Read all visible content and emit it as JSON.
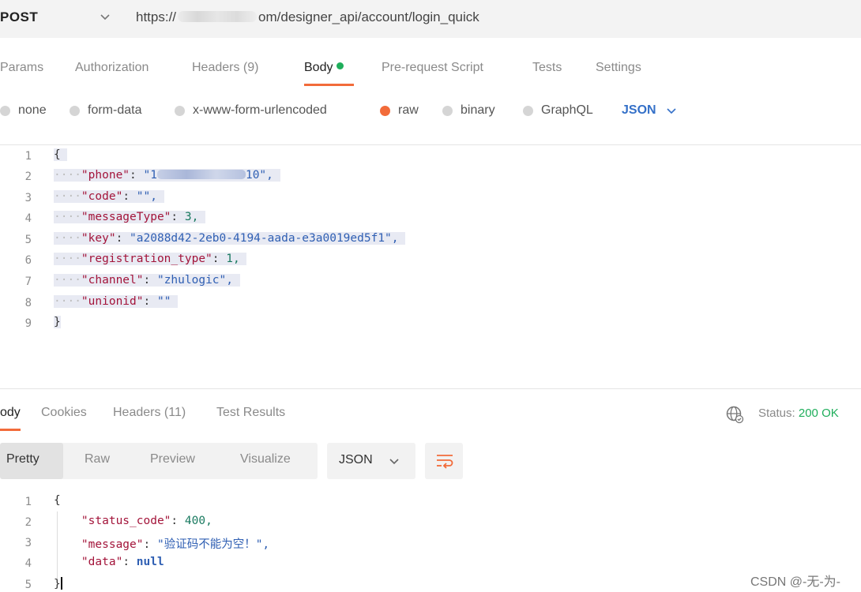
{
  "request": {
    "method": "POST",
    "url_prefix": "https://",
    "url_suffix": "om/designer_api/account/login_quick"
  },
  "tabs": [
    "Params",
    "Authorization",
    "Headers (9)",
    "Body",
    "Pre-request Script",
    "Tests",
    "Settings"
  ],
  "active_tab": "Body",
  "body_types": [
    "none",
    "form-data",
    "x-www-form-urlencoded",
    "raw",
    "binary",
    "GraphQL"
  ],
  "selected_body_type": "raw",
  "body_language": "JSON",
  "request_body": {
    "line_numbers": [
      "1",
      "2",
      "3",
      "4",
      "5",
      "6",
      "7",
      "8",
      "9"
    ],
    "open_brace": "{",
    "close_brace": "}",
    "fields": [
      {
        "key": "\"phone\"",
        "value": "\"1",
        "value_tail": "10\","
      },
      {
        "key": "\"code\"",
        "value": "\"\","
      },
      {
        "key": "\"messageType\"",
        "value": "3,"
      },
      {
        "key": "\"key\"",
        "value": "\"a2088d42-2eb0-4194-aada-e3a0019ed5f1\","
      },
      {
        "key": "\"registration_type\"",
        "value": "1,"
      },
      {
        "key": "\"channel\"",
        "value": "\"zhulogic\","
      },
      {
        "key": "\"unionid\"",
        "value": "\"\""
      }
    ]
  },
  "response": {
    "tabs": [
      "ody",
      "Cookies",
      "Headers (11)",
      "Test Results"
    ],
    "status_label": "Status:",
    "status_value": "200 OK",
    "view_modes": [
      "Pretty",
      "Raw",
      "Preview",
      "Visualize"
    ],
    "format": "JSON",
    "line_numbers": [
      "1",
      "2",
      "3",
      "4",
      "5"
    ],
    "open_brace": "{",
    "close_brace": "}",
    "fields": [
      {
        "key": "\"status_code\"",
        "value": "400,"
      },
      {
        "key": "\"message\"",
        "value": "\"验证码不能为空！\","
      },
      {
        "key": "\"data\"",
        "value": "null"
      }
    ]
  },
  "watermark": "CSDN @-无-为-",
  "colors": {
    "accent": "#f26b3a",
    "status_ok": "#1fae5b",
    "link_blue": "#3470c8",
    "json_key": "#a3143a",
    "json_string": "#2f5fb3"
  }
}
